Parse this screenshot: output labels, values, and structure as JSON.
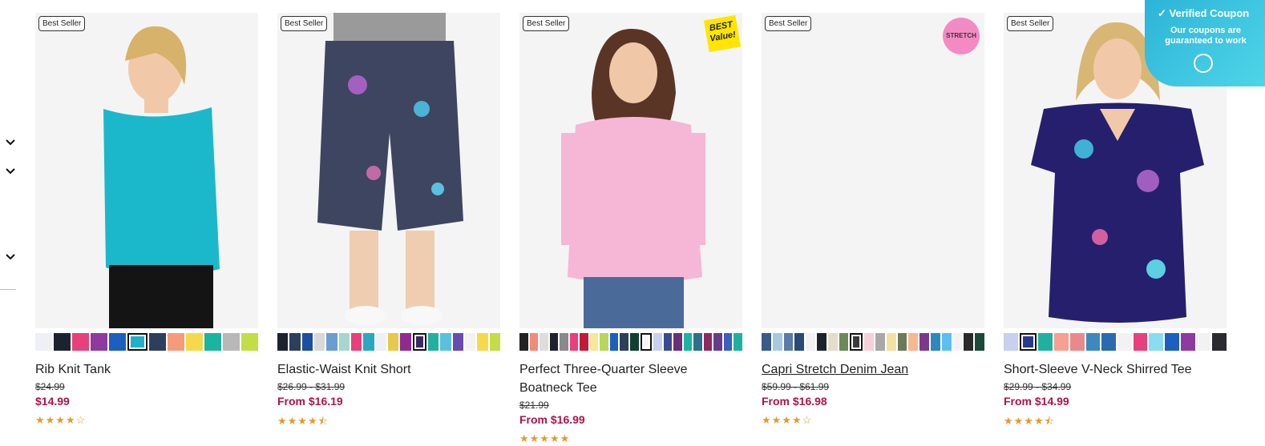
{
  "products": [
    {
      "badge": "Best Seller",
      "name": "Rib Knit Tank",
      "was": "$24.99",
      "now": "$14.99",
      "stars": "★★★★☆",
      "swatches": [
        "#eef0f5",
        "#1c2330",
        "#e8407a",
        "#8f3a9e",
        "#1b5fbf",
        "#1fb1c9",
        "#2e3f5c",
        "#f59b7a",
        "#f5d94a",
        "#1ab5a0",
        "#b8b8b8",
        "#c3dd46"
      ],
      "selected": 5,
      "underline": false
    },
    {
      "badge": "Best Seller",
      "name": "Elastic-Waist Knit Short",
      "was": "$26.99 - $31.99",
      "now": "From $16.19",
      "stars": "★★★★⯪",
      "swatches": [
        "#1c2330",
        "#2e3f5c",
        "#1b4f9f",
        "#d8d8d8",
        "#6a9ed0",
        "#a5d7ce",
        "#e8407a",
        "#2aa8c0",
        "#eef0f5",
        "#e8c84a",
        "#8f2a8e",
        "#3a2a60",
        "#1fb1a0",
        "#5bc0de",
        "#6a4ab0",
        "#f2f2f2",
        "#f5d94a",
        "#c3dd46"
      ],
      "selected": 11,
      "underline": false
    },
    {
      "badge": "Best Seller",
      "tag": "BEST Value!",
      "name": "Perfect Three-Quarter Sleeve Boatneck Tee",
      "was": "$21.99",
      "now": "From $16.99",
      "stars": "★★★★★",
      "swatches": [
        "#222",
        "#f28a78",
        "#ddd",
        "#1c2330",
        "#8a8a8a",
        "#e8407a",
        "#c21b3a",
        "#f5e89a",
        "#b8d65a",
        "#1b5fbf",
        "#2e3f5c",
        "#0f4030",
        "#f5f5f5",
        "#c8d0f0",
        "#3a4a90",
        "#6a2f7a",
        "#1ab5a0",
        "#2e6f8a",
        "#8e2a5e",
        "#6a3a8a",
        "#3a60c0",
        "#1fb1a0"
      ],
      "selected": 12,
      "underline": false
    },
    {
      "badge": "Best Seller",
      "tag": "STRETCH",
      "name": "Capri Stretch Denim Jean",
      "was": "$59.99 - $61.99",
      "now": "From $16.98",
      "stars": "★★★★☆",
      "swatches": [
        "#3a5a8a",
        "#a8c8e0",
        "#5a7aa8",
        "#2a4a78",
        "#f2f2f2",
        "#1c2330",
        "#e6dcc8",
        "#6a8a5a",
        "#3a3a3a",
        "#f5d0d8",
        "#a8a8a8",
        "#f5e0a0",
        "#6a7a5a",
        "#f5b890",
        "#7a3a8a",
        "#2a8ac0",
        "#5bc0f0",
        "#f2f2f2",
        "#2a2a2a",
        "#1a4a3a"
      ],
      "selected": 8,
      "underline": true
    },
    {
      "badge": "Best Seller",
      "name": "Short-Sleeve V-Neck Shirred Tee",
      "was": "$29.99 - $34.99",
      "now": "From $14.99",
      "stars": "★★★★⯪",
      "swatches": [
        "#c8d0f0",
        "#2a3a8a",
        "#1fb1a0",
        "#f5a090",
        "#e88a8a",
        "#3a8ac0",
        "#2a6ab0",
        "#f2f2f2",
        "#e8407a",
        "#8adcf0",
        "#1b5fbf",
        "#8f3a9e",
        "#f2f2f2",
        "#2a2a30"
      ],
      "selected": 1,
      "underline": false
    }
  ],
  "coupon": {
    "title": "Verified Coupon",
    "body": "Our coupons are guaranteed to work"
  },
  "icons": [
    "chevron-down-icon",
    "check-circle-icon",
    "coupon-chat-icon"
  ]
}
